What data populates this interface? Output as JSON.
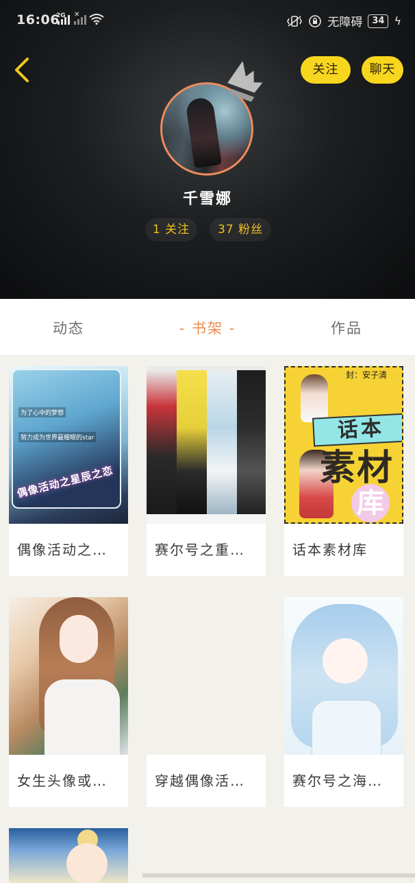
{
  "status_bar": {
    "time": "16:06",
    "network": "2G",
    "accessibility_label": "无障碍",
    "battery": "34"
  },
  "header": {
    "follow_label": "关注",
    "chat_label": "聊天",
    "username": "千雪娜",
    "following": "1 关注",
    "fans": "37 粉丝",
    "avatar_border_color": "#ec8c5c",
    "pill_color": "#f8d61e",
    "stat_color": "#f0c21c"
  },
  "tabs": [
    {
      "label": "动态"
    },
    {
      "label": "书架",
      "active": true
    },
    {
      "label": "作品"
    }
  ],
  "tab_active_color": "#ee8a50",
  "shelf": {
    "items": [
      {
        "title": "偶像活动之…",
        "cover_line1": "为了心中的梦想",
        "cover_line2": "努力成为世界最耀眼的star",
        "cover_text": "偶像活动之星辰之恋"
      },
      {
        "title": "赛尔号之重…"
      },
      {
        "title": "话本素材库",
        "cover_author": "封：安子清",
        "cover_word1": "话本",
        "cover_word2": "素材",
        "cover_word3": "库"
      },
      {
        "title": "女生头像或…"
      },
      {
        "title": "穿越偶像活…"
      },
      {
        "title": "赛尔号之海…"
      }
    ]
  }
}
